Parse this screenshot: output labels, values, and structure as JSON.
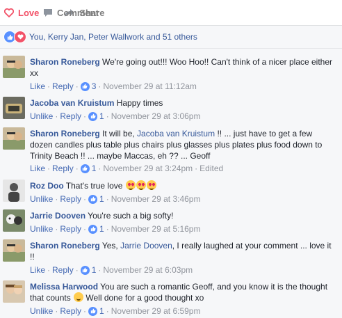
{
  "actions": {
    "love_label": "Love",
    "comment_label": "Comment",
    "share_label": "Share"
  },
  "likes_summary": "You, Kerry Jan, Peter Wallwork and 51 others",
  "colors": {
    "love": "#f25268",
    "link": "#365899",
    "like_blue": "#5890ff",
    "meta": "#90949c"
  },
  "comments": [
    {
      "author": "Sharon Roneberg",
      "text": "We're going out!!! Woo Hoo!! Can't think of a nicer place either xx",
      "like_action": "Like",
      "reply_action": "Reply",
      "like_count": "3",
      "timestamp": "November 29 at 11:12am"
    },
    {
      "author": "Jacoba van Kruistum",
      "text": "Happy times",
      "like_action": "Unlike",
      "reply_action": "Reply",
      "like_count": "1",
      "timestamp": "November 29 at 3:06pm"
    },
    {
      "author": "Sharon Roneberg",
      "text_before": "It will be, ",
      "mention": "Jacoba van Kruistum",
      "text_after": " !! ... just have to get a few dozen candles plus table plus chairs plus glasses plus plates plus food down to Trinity Beach !! ... maybe Maccas, eh ?? ... Geoff",
      "like_action": "Like",
      "reply_action": "Reply",
      "like_count": "1",
      "timestamp": "November 29 at 3:24pm",
      "edited": "Edited"
    },
    {
      "author": "Roz Doo",
      "text": "That's true love",
      "like_action": "Unlike",
      "reply_action": "Reply",
      "like_count": "1",
      "timestamp": "November 29 at 3:46pm"
    },
    {
      "author": "Jarrie Dooven",
      "text": "You're such a big softy!",
      "like_action": "Unlike",
      "reply_action": "Reply",
      "like_count": "1",
      "timestamp": "November 29 at 5:16pm"
    },
    {
      "author": "Sharon Roneberg",
      "text_before": "Yes, ",
      "mention": "Jarrie Dooven",
      "text_after": ", I really laughed at your comment ... love it !!",
      "like_action": "Like",
      "reply_action": "Reply",
      "like_count": "1",
      "timestamp": "November 29 at 6:03pm"
    },
    {
      "author": "Melissa Harwood",
      "text_before": "You are such a romantic Geoff, and you know it is the thought that counts ",
      "text_after": " Well done for a good thought xo",
      "like_action": "Unlike",
      "reply_action": "Reply",
      "like_count": "1",
      "timestamp": "November 29 at 6:59pm"
    }
  ]
}
